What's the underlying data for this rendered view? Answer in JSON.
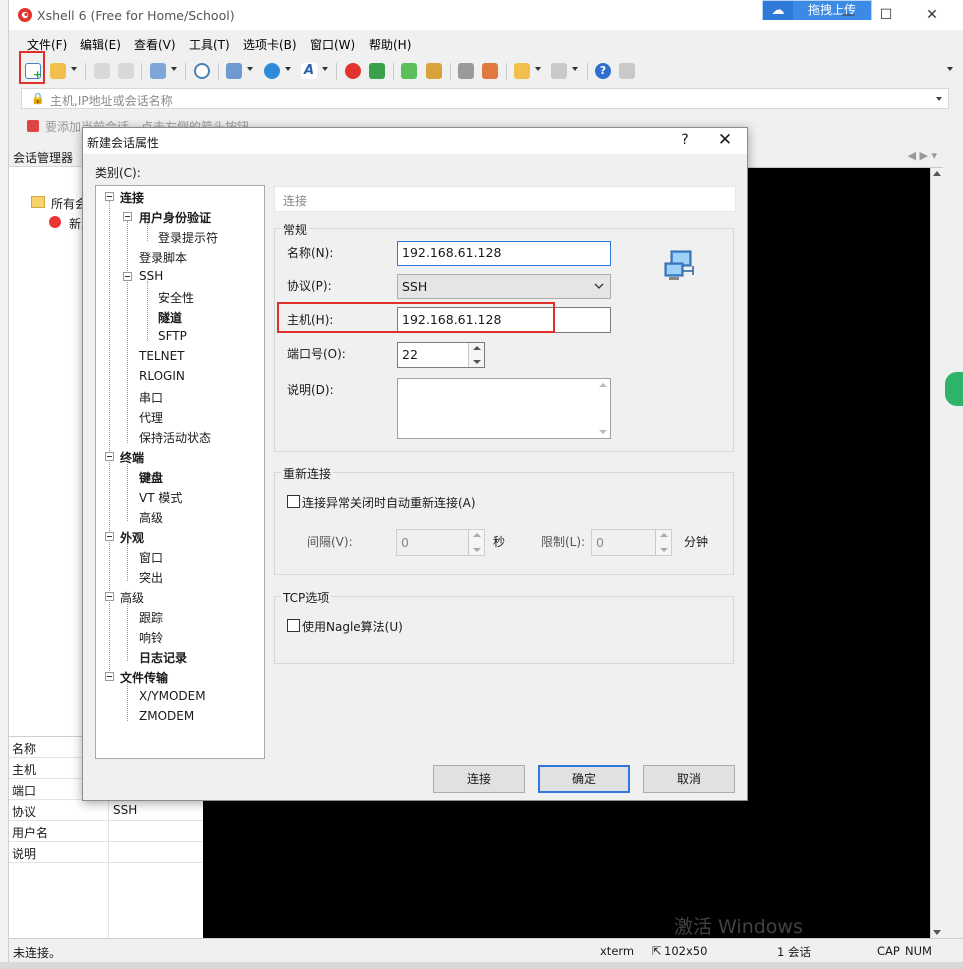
{
  "app": {
    "title": "Xshell 6 (Free for Home/School)",
    "upload_label": "拖拽上传",
    "window_controls": {
      "minimize": "—",
      "maximize": "☐",
      "close": "✕"
    }
  },
  "menu": [
    "文件(F)",
    "编辑(E)",
    "查看(V)",
    "工具(T)",
    "选项卡(B)",
    "窗口(W)",
    "帮助(H)"
  ],
  "address_bar": {
    "placeholder": "主机,IP地址或会话名称"
  },
  "hint_bar": {
    "text": "要添加当前会话，点击左侧的箭头按钮。"
  },
  "session_manager": {
    "title": "会话管理器",
    "tree": {
      "root": "所有会话",
      "child": "新建会话"
    },
    "properties": [
      {
        "key": "名称",
        "value": ""
      },
      {
        "key": "主机",
        "value": ""
      },
      {
        "key": "端口",
        "value": ""
      },
      {
        "key": "协议",
        "value": "SSH"
      },
      {
        "key": "用户名",
        "value": ""
      },
      {
        "key": "说明",
        "value": ""
      }
    ]
  },
  "status_bar": {
    "left": "未连接。",
    "terminal_type": "xterm",
    "size": "102x50",
    "session": "1 会话",
    "cap": "CAP",
    "num": "NUM"
  },
  "watermark": "激活 Windows",
  "dialog": {
    "title": "新建会话属性",
    "help": "?",
    "close": "✕",
    "category_label": "类别(C):",
    "tree": [
      {
        "label": "连接",
        "bold": true
      },
      {
        "label": "用户身份验证",
        "bold": true
      },
      {
        "label": "登录提示符",
        "bold": false
      },
      {
        "label": "登录脚本",
        "bold": false
      },
      {
        "label": "SSH",
        "bold": false
      },
      {
        "label": "安全性",
        "bold": false
      },
      {
        "label": "隧道",
        "bold": true
      },
      {
        "label": "SFTP",
        "bold": false
      },
      {
        "label": "TELNET",
        "bold": false
      },
      {
        "label": "RLOGIN",
        "bold": false
      },
      {
        "label": "串口",
        "bold": false
      },
      {
        "label": "代理",
        "bold": false
      },
      {
        "label": "保持活动状态",
        "bold": false
      },
      {
        "label": "终端",
        "bold": true
      },
      {
        "label": "键盘",
        "bold": true
      },
      {
        "label": "VT 模式",
        "bold": false
      },
      {
        "label": "高级",
        "bold": false
      },
      {
        "label": "外观",
        "bold": true
      },
      {
        "label": "窗口",
        "bold": false
      },
      {
        "label": "突出",
        "bold": false
      },
      {
        "label": "高级",
        "bold": false
      },
      {
        "label": "跟踪",
        "bold": false
      },
      {
        "label": "响铃",
        "bold": false
      },
      {
        "label": "日志记录",
        "bold": true
      },
      {
        "label": "文件传输",
        "bold": true
      },
      {
        "label": "X/YMODEM",
        "bold": false
      },
      {
        "label": "ZMODEM",
        "bold": false
      }
    ],
    "section_header": "连接",
    "general": {
      "title": "常规",
      "name_label": "名称(N):",
      "name_value": "192.168.61.128",
      "protocol_label": "协议(P):",
      "protocol_value": "SSH",
      "host_label": "主机(H):",
      "host_value": "192.168.61.128",
      "port_label": "端口号(O):",
      "port_value": "22",
      "desc_label": "说明(D):",
      "desc_value": ""
    },
    "reconnect": {
      "title": "重新连接",
      "checkbox_label": "连接异常关闭时自动重新连接(A)",
      "interval_label": "间隔(V):",
      "interval_value": "0",
      "interval_unit": "秒",
      "limit_label": "限制(L):",
      "limit_value": "0",
      "limit_unit": "分钟"
    },
    "tcp": {
      "title": "TCP选项",
      "nagle_label": "使用Nagle算法(U)"
    },
    "buttons": {
      "connect": "连接",
      "ok": "确定",
      "cancel": "取消"
    }
  }
}
